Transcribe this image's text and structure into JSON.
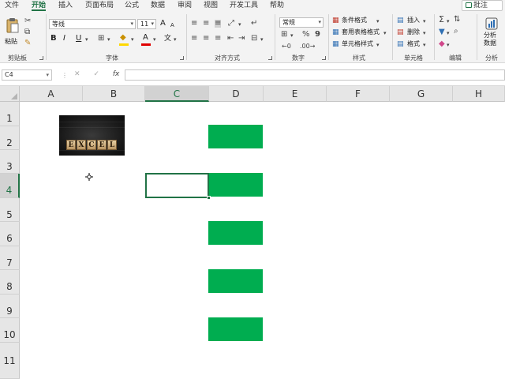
{
  "tabs": [
    "文件",
    "开始",
    "插入",
    "页面布局",
    "公式",
    "数据",
    "审阅",
    "视图",
    "开发工具",
    "帮助"
  ],
  "active_tab": "开始",
  "comment_button": "批注",
  "ribbon": {
    "clipboard": {
      "paste": "粘贴",
      "label": "剪贴板"
    },
    "font": {
      "name": "等线",
      "size": "11",
      "bold": "B",
      "italic": "I",
      "underline": "U",
      "grow": "A",
      "shrink": "A",
      "color_letter": "A",
      "wen": "文",
      "label": "字体"
    },
    "alignment": {
      "label": "对齐方式"
    },
    "number": {
      "format": "常规",
      "label": "数字"
    },
    "styles": {
      "conditional": "条件格式",
      "table": "套用表格格式",
      "cell": "单元格样式",
      "label": "样式"
    },
    "cells": {
      "insert": "插入",
      "delete": "删除",
      "format": "格式",
      "label": "单元格"
    },
    "editing": {
      "label": "编辑"
    },
    "analyze": {
      "line1": "分析",
      "line2": "数据",
      "label": "分析"
    }
  },
  "formula_bar": {
    "name_box": "C4",
    "cancel": "✕",
    "enter": "✓",
    "fx": "fx",
    "formula": ""
  },
  "columns": [
    "A",
    "B",
    "C",
    "D",
    "E",
    "F",
    "G",
    "H"
  ],
  "rows": [
    "1",
    "2",
    "3",
    "4",
    "5",
    "6",
    "7",
    "8",
    "9",
    "10",
    "11"
  ],
  "selected_cell": "C4",
  "image_text": [
    "E",
    "X",
    "C",
    "E",
    "L"
  ],
  "colors": {
    "accent": "#217346",
    "green_fill": "#00ad50"
  }
}
